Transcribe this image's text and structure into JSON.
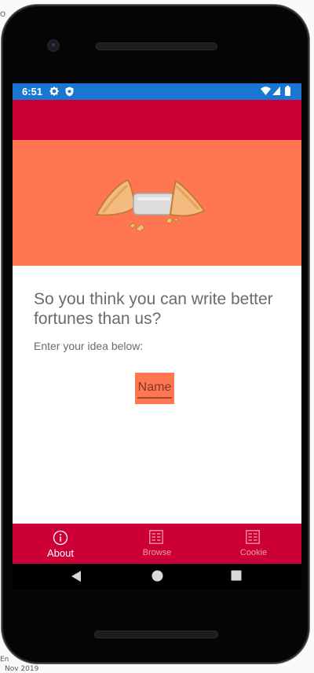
{
  "desktop": {
    "top_fragment": "O",
    "bottom_fragment_1": "En",
    "bottom_fragment_2": "Nov 2019"
  },
  "status_bar": {
    "time": "6:51",
    "background": "#1976d2",
    "left_icons": [
      "gear-icon",
      "shield-icon"
    ],
    "right_icons": [
      "wifi-icon",
      "signal-icon",
      "battery-icon"
    ]
  },
  "app": {
    "toolbar_color": "#cc0036",
    "hero_color": "#ff7650",
    "hero_image": "fortune-cookie-icon",
    "headline": "So you think you can write better fortunes than us?",
    "subtext": "Enter your idea below:",
    "name_field": {
      "placeholder": "Name",
      "value": ""
    }
  },
  "bottom_nav": {
    "items": [
      {
        "label": "About",
        "icon": "info-icon",
        "active": true
      },
      {
        "label": "Browse",
        "icon": "list-icon",
        "active": false
      },
      {
        "label": "Cookie",
        "icon": "list-icon",
        "active": false
      }
    ]
  },
  "system_nav": {
    "buttons": [
      "back-icon",
      "home-icon",
      "recents-icon"
    ]
  }
}
